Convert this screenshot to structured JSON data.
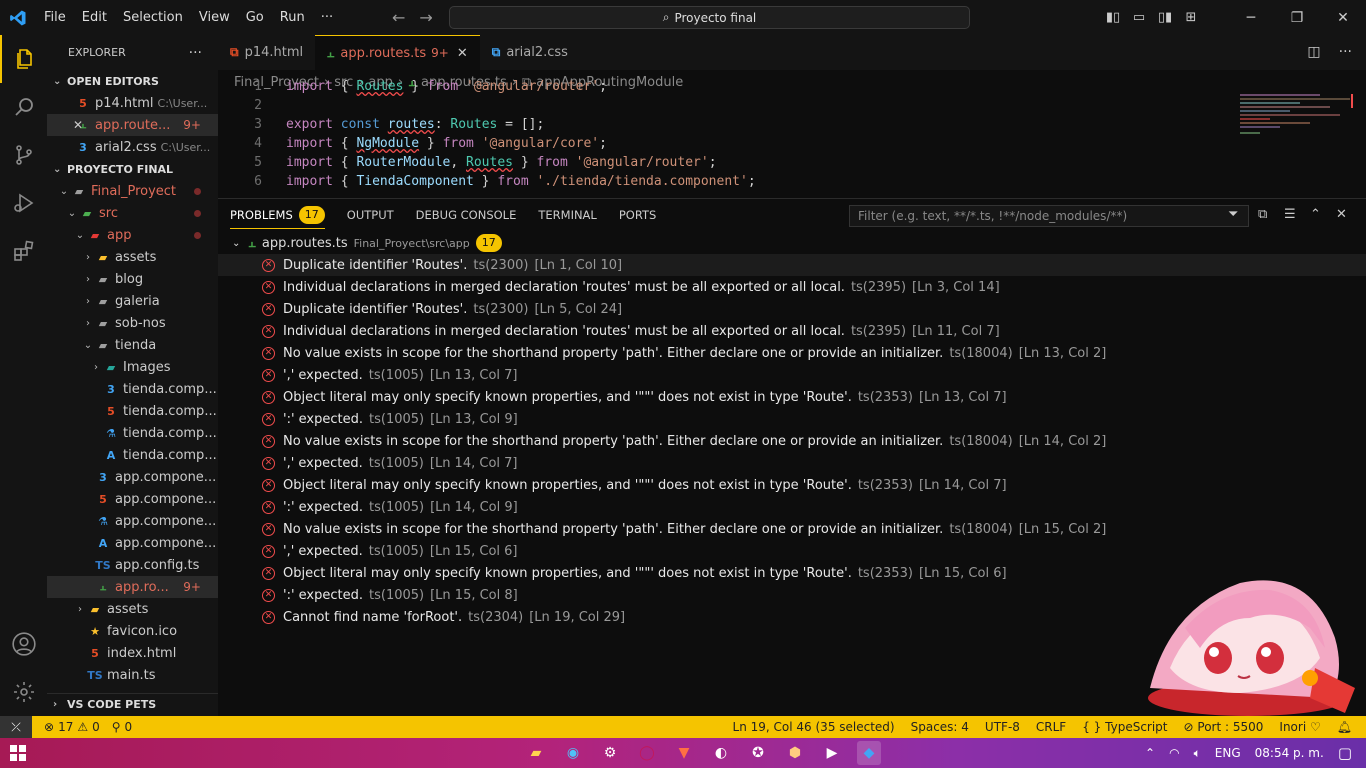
{
  "titlebar": {
    "menu": [
      "File",
      "Edit",
      "Selection",
      "View",
      "Go",
      "Run",
      "···"
    ],
    "search": "Proyecto final"
  },
  "explorer": {
    "title": "EXPLORER",
    "open_editors_label": "OPEN EDITORS",
    "open_editors": [
      {
        "icon": "html",
        "name": "p14.html",
        "path": "C:\\User..."
      },
      {
        "icon": "ts-routing",
        "name": "app.route...",
        "count": "9+",
        "close": "✕"
      },
      {
        "icon": "css",
        "name": "arial2.css",
        "path": "C:\\User..."
      }
    ],
    "project_label": "PROYECTO FINAL",
    "tree": [
      {
        "indent": 0,
        "chev": "⌄",
        "icon": "folder",
        "name": "Final_Proyect",
        "color": "#e06c5a",
        "dot": true
      },
      {
        "indent": 1,
        "chev": "⌄",
        "icon": "folder-src",
        "name": "src",
        "color": "#e06c5a",
        "dot": true
      },
      {
        "indent": 2,
        "chev": "⌄",
        "icon": "folder-app",
        "name": "app",
        "color": "#e06c5a",
        "dot": true
      },
      {
        "indent": 3,
        "chev": "›",
        "icon": "folder-assets",
        "name": "assets"
      },
      {
        "indent": 3,
        "chev": "›",
        "icon": "folder",
        "name": "blog"
      },
      {
        "indent": 3,
        "chev": "›",
        "icon": "folder",
        "name": "galeria"
      },
      {
        "indent": 3,
        "chev": "›",
        "icon": "folder",
        "name": "sob-nos"
      },
      {
        "indent": 3,
        "chev": "⌄",
        "icon": "folder",
        "name": "tienda"
      },
      {
        "indent": 4,
        "chev": "›",
        "icon": "folder-images",
        "name": "Images"
      },
      {
        "indent": 4,
        "chev": "",
        "icon": "css",
        "name": "tienda.comp..."
      },
      {
        "indent": 4,
        "chev": "",
        "icon": "html",
        "name": "tienda.comp..."
      },
      {
        "indent": 4,
        "chev": "",
        "icon": "test",
        "name": "tienda.comp..."
      },
      {
        "indent": 4,
        "chev": "",
        "icon": "angular",
        "name": "tienda.comp..."
      },
      {
        "indent": 3,
        "chev": "",
        "icon": "css",
        "name": "app.compone..."
      },
      {
        "indent": 3,
        "chev": "",
        "icon": "html",
        "name": "app.compone..."
      },
      {
        "indent": 3,
        "chev": "",
        "icon": "test",
        "name": "app.compone..."
      },
      {
        "indent": 3,
        "chev": "",
        "icon": "angular",
        "name": "app.compone..."
      },
      {
        "indent": 3,
        "chev": "",
        "icon": "ts",
        "name": "app.config.ts"
      },
      {
        "indent": 3,
        "chev": "",
        "icon": "ts-routing",
        "name": "app.ro...",
        "color": "#e06c5a",
        "count": "9+",
        "selected": true
      },
      {
        "indent": 2,
        "chev": "›",
        "icon": "folder-assets",
        "name": "assets"
      },
      {
        "indent": 2,
        "chev": "",
        "icon": "star",
        "name": "favicon.ico"
      },
      {
        "indent": 2,
        "chev": "",
        "icon": "html",
        "name": "index.html"
      },
      {
        "indent": 2,
        "chev": "",
        "icon": "ts",
        "name": "main.ts"
      }
    ],
    "pets_label": "VS CODE PETS"
  },
  "tabs": [
    {
      "icon": "html",
      "label": "p14.html",
      "active": false
    },
    {
      "icon": "ts-routing",
      "label": "app.routes.ts",
      "suffix": "9+",
      "active": true
    },
    {
      "icon": "css",
      "label": "arial2.css",
      "active": false
    }
  ],
  "breadcrumb": [
    "Final_Proyect",
    "src",
    "app",
    "app.routes.ts",
    "appAppRoutingModule"
  ],
  "code_lines": [
    {
      "n": "1",
      "html": "<span class='kw'>import</span> <span class='pn'>{ </span><span class='ty squig'>Routes</span><span class='pn'> } </span><span class='kw'>from</span> <span class='st'>'@angular/router'</span><span class='pn'>;</span>"
    },
    {
      "n": "2",
      "html": ""
    },
    {
      "n": "3",
      "html": "<span class='kw'>export</span> <span class='kw2'>const</span> <span class='vr squig'>routes</span><span class='pn'>: </span><span class='ty'>Routes</span><span class='pn'> = [];</span>"
    },
    {
      "n": "4",
      "html": "<span class='kw'>import</span> <span class='pn'>{ </span><span class='vr squig'>NgModule</span><span class='pn'> } </span><span class='kw'>from</span> <span class='st'>'@angular/core'</span><span class='pn'>;</span>"
    },
    {
      "n": "5",
      "html": "<span class='kw'>import</span> <span class='pn'>{ </span><span class='vr'>RouterModule</span><span class='pn'>, </span><span class='ty squig'>Routes</span><span class='pn'> } </span><span class='kw'>from</span> <span class='st'>'@angular/router'</span><span class='pn'>;</span>"
    },
    {
      "n": "6",
      "html": "<span class='kw'>import</span> <span class='pn'>{ </span><span class='vr'>TiendaComponent</span><span class='pn'> } </span><span class='kw'>from</span> <span class='st'>'./tienda/tienda.component'</span><span class='pn'>;</span>"
    }
  ],
  "panel": {
    "tabs": [
      "PROBLEMS",
      "OUTPUT",
      "DEBUG CONSOLE",
      "TERMINAL",
      "PORTS"
    ],
    "problems_count": "17",
    "filter_placeholder": "Filter (e.g. text, **/*.ts, !**/node_modules/**)",
    "file": {
      "name": "app.routes.ts",
      "path": "Final_Proyect\\src\\app",
      "count": "17"
    },
    "problems": [
      {
        "msg": "Duplicate identifier 'Routes'.",
        "src": "ts(2300)",
        "loc": "[Ln 1, Col 10]"
      },
      {
        "msg": "Individual declarations in merged declaration 'routes' must be all exported or all local.",
        "src": "ts(2395)",
        "loc": "[Ln 3, Col 14]"
      },
      {
        "msg": "Duplicate identifier 'Routes'.",
        "src": "ts(2300)",
        "loc": "[Ln 5, Col 24]"
      },
      {
        "msg": "Individual declarations in merged declaration 'routes' must be all exported or all local.",
        "src": "ts(2395)",
        "loc": "[Ln 11, Col 7]"
      },
      {
        "msg": "No value exists in scope for the shorthand property 'path'. Either declare one or provide an initializer.",
        "src": "ts(18004)",
        "loc": "[Ln 13, Col 2]"
      },
      {
        "msg": "',' expected.",
        "src": "ts(1005)",
        "loc": "[Ln 13, Col 7]"
      },
      {
        "msg": "Object literal may only specify known properties, and '\"\"' does not exist in type 'Route'.",
        "src": "ts(2353)",
        "loc": "[Ln 13, Col 7]"
      },
      {
        "msg": "':' expected.",
        "src": "ts(1005)",
        "loc": "[Ln 13, Col 9]"
      },
      {
        "msg": "No value exists in scope for the shorthand property 'path'. Either declare one or provide an initializer.",
        "src": "ts(18004)",
        "loc": "[Ln 14, Col 2]"
      },
      {
        "msg": "',' expected.",
        "src": "ts(1005)",
        "loc": "[Ln 14, Col 7]"
      },
      {
        "msg": "Object literal may only specify known properties, and '\"\"' does not exist in type 'Route'.",
        "src": "ts(2353)",
        "loc": "[Ln 14, Col 7]"
      },
      {
        "msg": "':' expected.",
        "src": "ts(1005)",
        "loc": "[Ln 14, Col 9]"
      },
      {
        "msg": "No value exists in scope for the shorthand property 'path'. Either declare one or provide an initializer.",
        "src": "ts(18004)",
        "loc": "[Ln 15, Col 2]"
      },
      {
        "msg": "',' expected.",
        "src": "ts(1005)",
        "loc": "[Ln 15, Col 6]"
      },
      {
        "msg": "Object literal may only specify known properties, and '\"\"' does not exist in type 'Route'.",
        "src": "ts(2353)",
        "loc": "[Ln 15, Col 6]"
      },
      {
        "msg": "':' expected.",
        "src": "ts(1005)",
        "loc": "[Ln 15, Col 8]"
      },
      {
        "msg": "Cannot find name 'forRoot'.",
        "src": "ts(2304)",
        "loc": "[Ln 19, Col 29]"
      }
    ]
  },
  "statusbar": {
    "errors": "17",
    "warnings": "0",
    "ports": "0",
    "position": "Ln 19, Col 46 (35 selected)",
    "spaces": "Spaces: 4",
    "encoding": "UTF-8",
    "eol": "CRLF",
    "language": "TypeScript",
    "port": "Port : 5500",
    "user": "Inori"
  },
  "taskbar": {
    "lang": "ENG",
    "time": "08:54 p. m."
  },
  "colors": {
    "accent": "#f5c400",
    "error": "#f14c4c",
    "modified": "#e06c5a"
  }
}
